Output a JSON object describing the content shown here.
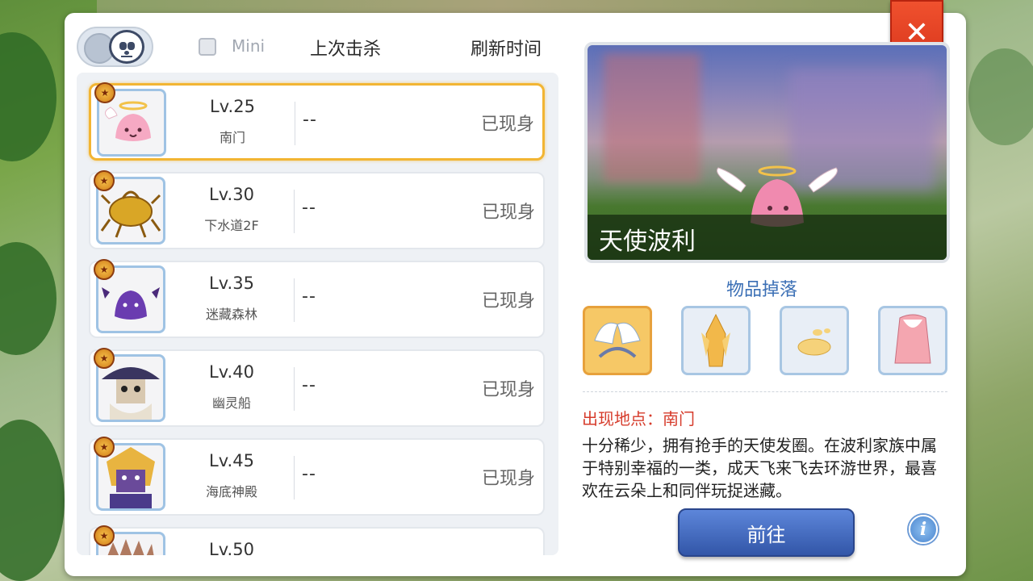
{
  "header": {
    "mini_label": "Mini",
    "col_last_kill": "上次击杀",
    "col_refresh": "刷新时间"
  },
  "monsters": [
    {
      "level": "Lv.25",
      "location": "南门",
      "last_kill": "--",
      "status": "已现身",
      "icon": "angel-poring-icon",
      "selected": true
    },
    {
      "level": "Lv.30",
      "location": "下水道2F",
      "last_kill": "--",
      "status": "已现身",
      "icon": "golden-thief-bug-icon",
      "selected": false
    },
    {
      "level": "Lv.35",
      "location": "迷藏森林",
      "last_kill": "--",
      "status": "已现身",
      "icon": "deviling-icon",
      "selected": false
    },
    {
      "level": "Lv.40",
      "location": "幽灵船",
      "last_kill": "--",
      "status": "已现身",
      "icon": "drake-icon",
      "selected": false
    },
    {
      "level": "Lv.45",
      "location": "海底神殿",
      "last_kill": "--",
      "status": "已现身",
      "icon": "strouf-icon",
      "selected": false
    },
    {
      "level": "Lv.50",
      "location": "",
      "last_kill": "",
      "status": "",
      "icon": "boss-icon",
      "selected": false
    }
  ],
  "detail": {
    "name": "天使波利",
    "drops_title": "物品掉落",
    "drops": [
      "angel-wing-headband-icon",
      "gold-crystal-icon",
      "jellopy-icon",
      "pink-coat-icon"
    ],
    "location_line": "出现地点：南门",
    "description": "十分稀少，拥有抢手的天使发圈。在波利家族中属于特别幸福的一类，成天飞来飞去环游世界，最喜欢在云朵上和同伴玩捉迷藏。",
    "go_label": "前往",
    "info_label": "i"
  },
  "close_label": "✕",
  "colors": {
    "accent_blue": "#3b6fb5",
    "location_red": "#d63b2b",
    "selected_border": "#f2b533",
    "close_red": "#e0401f"
  }
}
